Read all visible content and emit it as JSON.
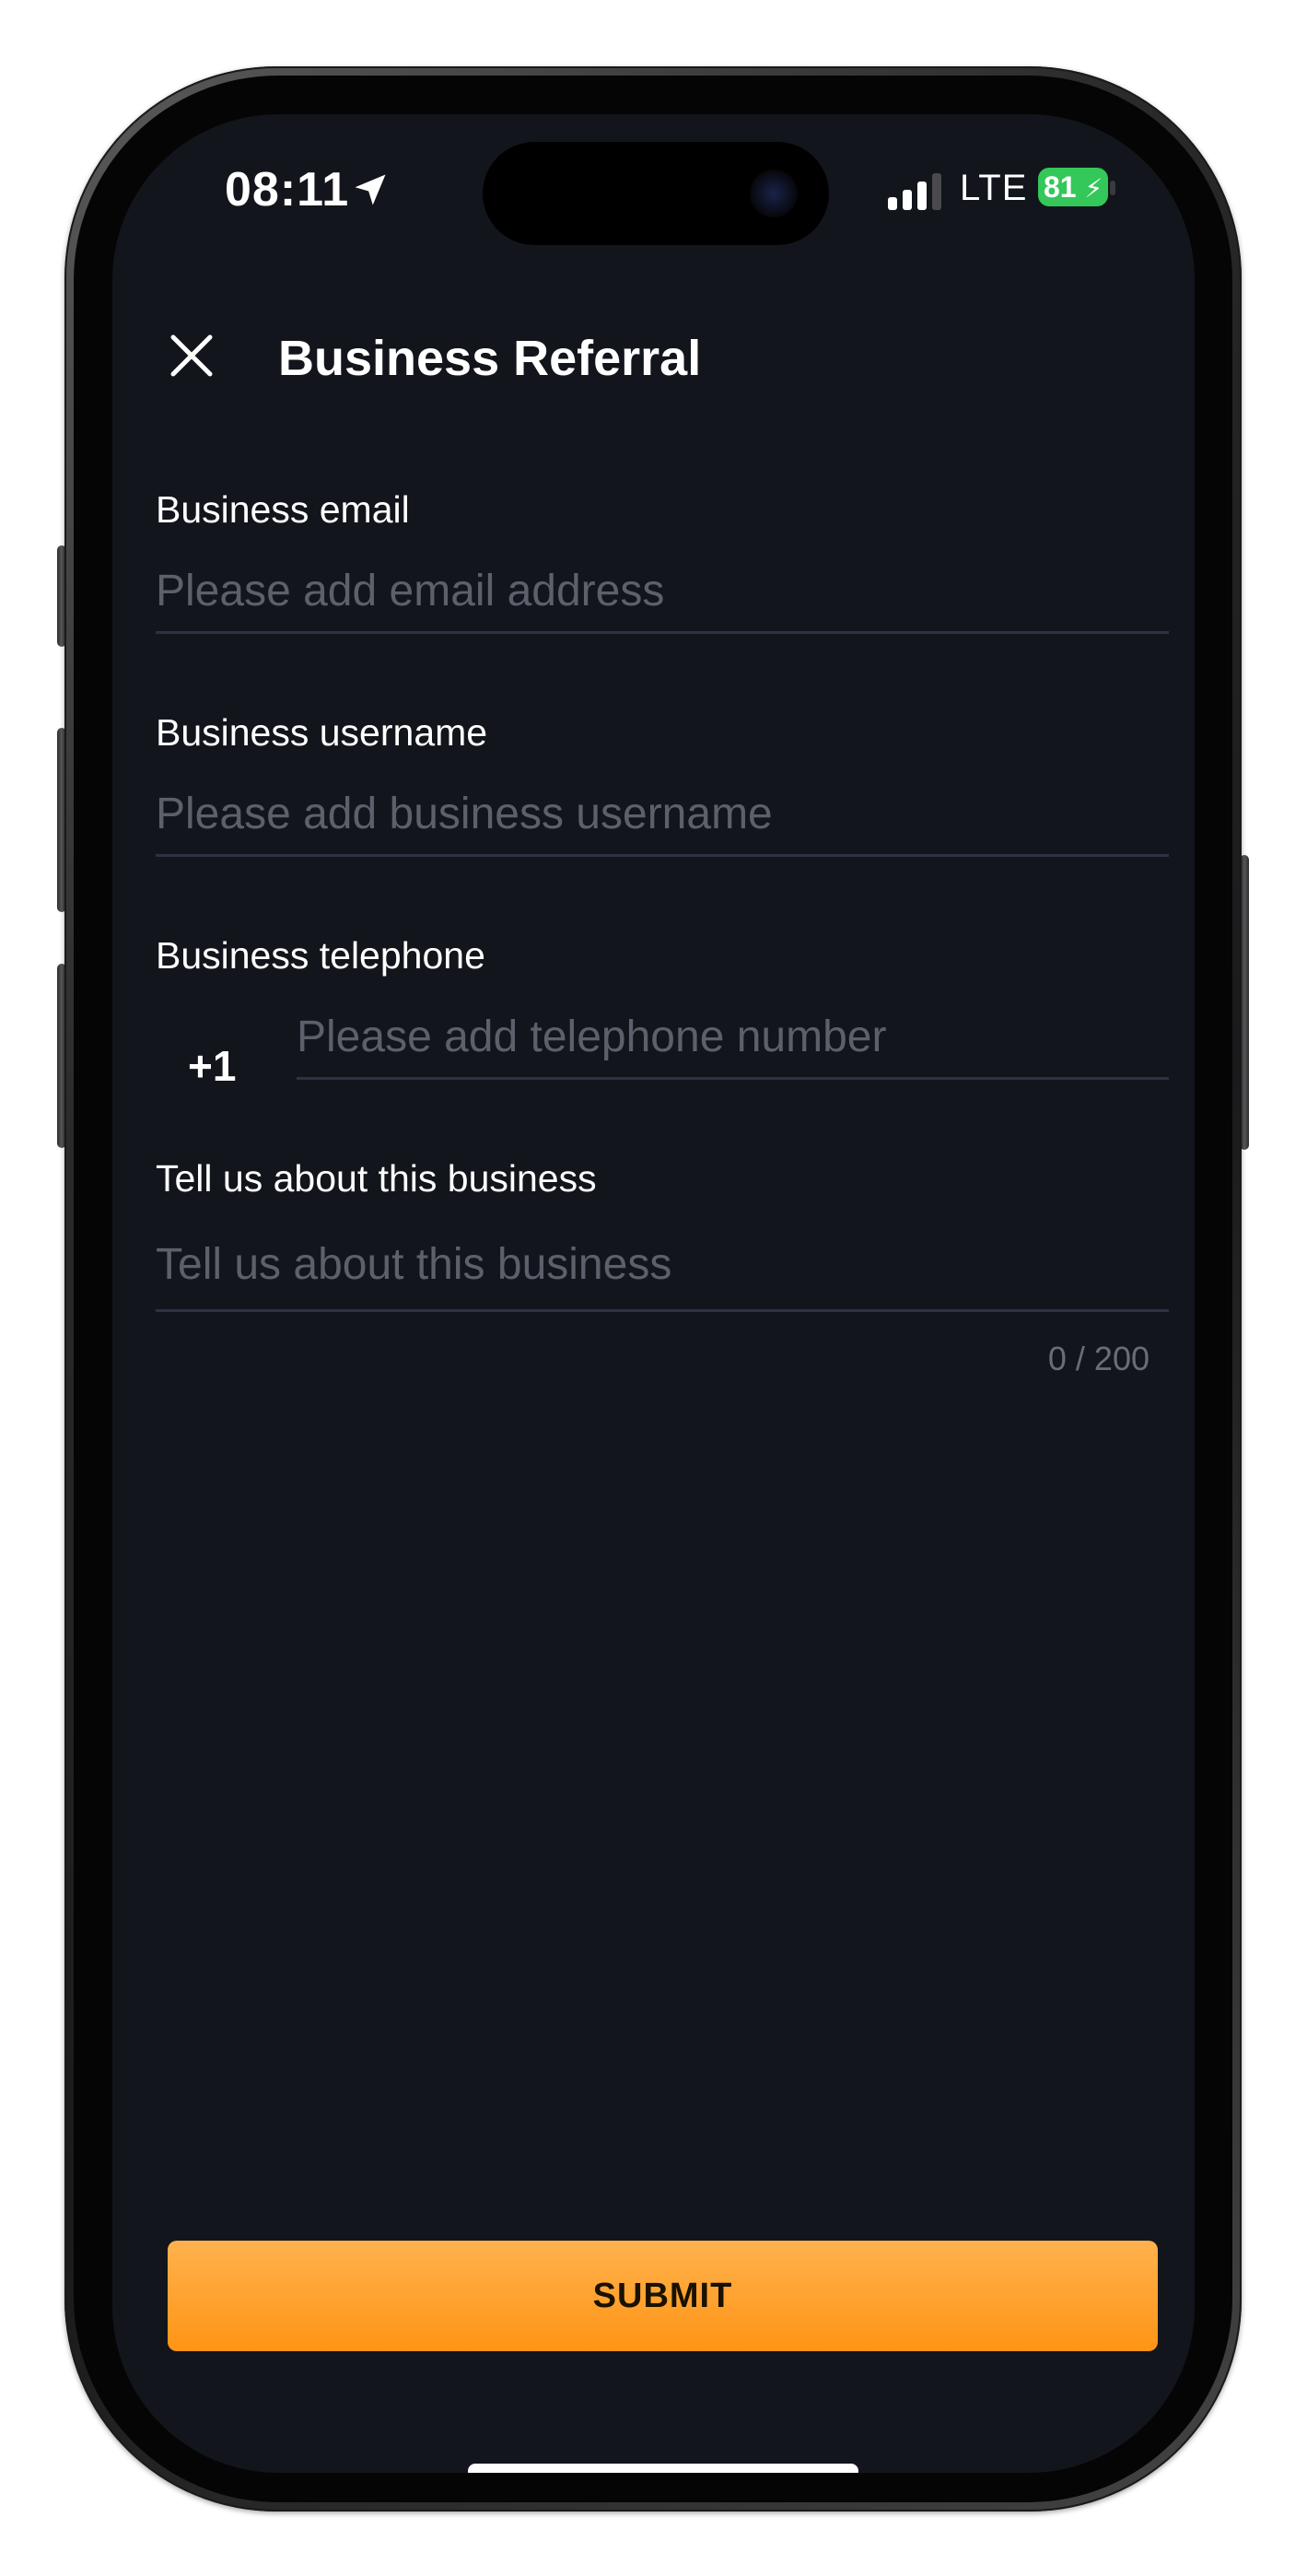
{
  "status_bar": {
    "time": "08:11",
    "network": "LTE",
    "battery": "81"
  },
  "header": {
    "title": "Business Referral"
  },
  "form": {
    "email": {
      "label": "Business email",
      "value": "",
      "placeholder": "Please add email address"
    },
    "username": {
      "label": "Business username",
      "value": "",
      "placeholder": "Please add business username"
    },
    "telephone": {
      "label": "Business telephone",
      "country_code": "+1",
      "value": "",
      "placeholder": "Please add telephone number"
    },
    "about": {
      "label": "Tell us about this business",
      "value": "",
      "placeholder": "Tell us about this business",
      "char_count": "0 / 200"
    }
  },
  "actions": {
    "submit_label": "SUBMIT"
  },
  "colors": {
    "background": "#13151c",
    "accent": "#ff9f1c",
    "divider": "#2c3145",
    "placeholder": "#5d606b",
    "battery": "#34c759"
  },
  "icons": {
    "close": "close-icon",
    "location": "location-arrow-icon",
    "signal": "cellular-signal-icon",
    "battery": "battery-charging-icon"
  }
}
